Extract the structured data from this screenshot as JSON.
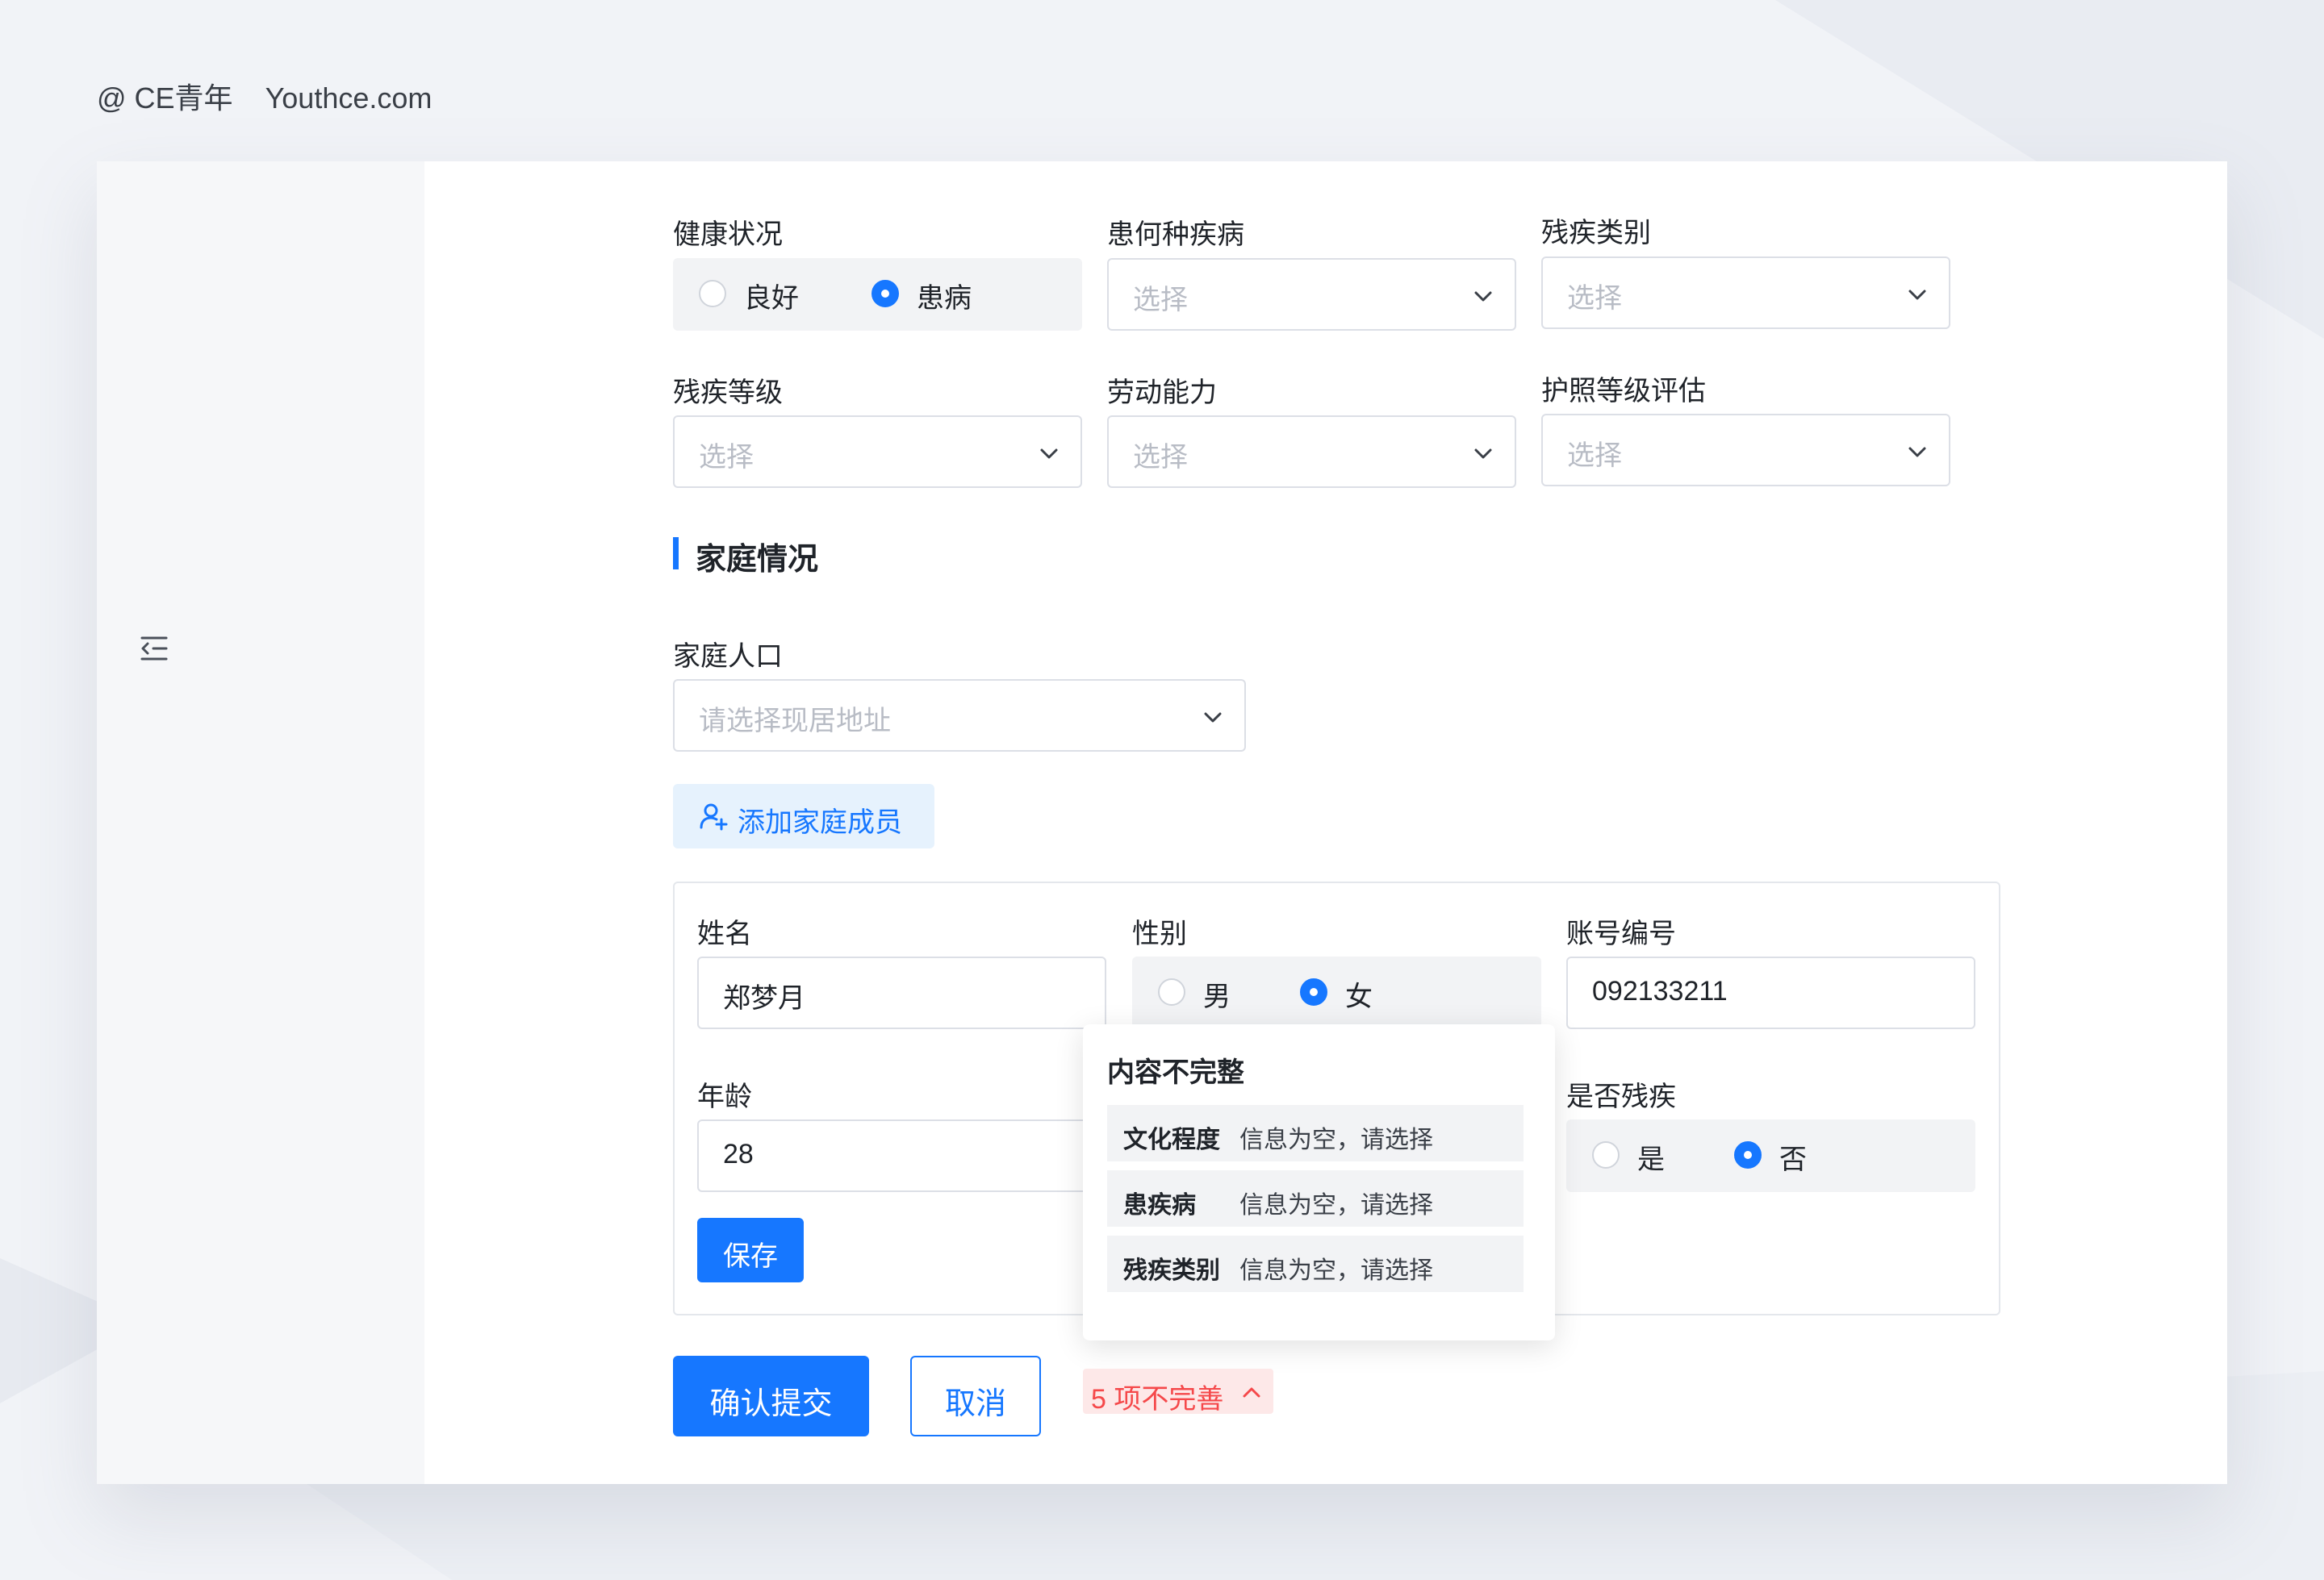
{
  "watermark": {
    "handle": "@ CE青年",
    "site": "Youthce.com"
  },
  "health": {
    "status": {
      "label": "健康状况",
      "options": [
        "良好",
        "患病"
      ],
      "selected": "患病"
    },
    "disease": {
      "label": "患何种疾病",
      "placeholder": "选择"
    },
    "disability_type": {
      "label": "残疾类别",
      "placeholder": "选择"
    },
    "disability_level": {
      "label": "残疾等级",
      "placeholder": "选择"
    },
    "labor_ability": {
      "label": "劳动能力",
      "placeholder": "选择"
    },
    "care_level": {
      "label": "护照等级评估",
      "placeholder": "选择"
    }
  },
  "family": {
    "section_title": "家庭情况",
    "population": {
      "label": "家庭人口",
      "placeholder": "请选择现居地址"
    },
    "add_member_label": "添加家庭成员",
    "member": {
      "name": {
        "label": "姓名",
        "value": "郑梦月"
      },
      "gender": {
        "label": "性别",
        "options": [
          "男",
          "女"
        ],
        "selected": "女"
      },
      "account": {
        "label": "账号编号",
        "value": "092133211"
      },
      "age": {
        "label": "年龄",
        "value": "28"
      },
      "disabled": {
        "label": "是否残疾",
        "options": [
          "是",
          "否"
        ],
        "selected": "否"
      },
      "save_label": "保存"
    }
  },
  "validation": {
    "title": "内容不完整",
    "issues": [
      {
        "field": "文化程度",
        "message": "信息为空，请选择"
      },
      {
        "field": "患疾病",
        "message": "信息为空，请选择"
      },
      {
        "field": "残疾类别",
        "message": "信息为空，请选择"
      }
    ],
    "summary": "5 项不完善"
  },
  "actions": {
    "submit_label": "确认提交",
    "cancel_label": "取消"
  },
  "colors": {
    "primary": "#1677ff",
    "error": "#f5484a",
    "error_bg": "#fde8e8",
    "sidebar": "#f6f7f9"
  },
  "icons": {
    "menu": "indent-left-icon",
    "add_user": "user-add-icon",
    "chevron": "chevron-down-icon",
    "expand": "chevron-up-icon"
  }
}
